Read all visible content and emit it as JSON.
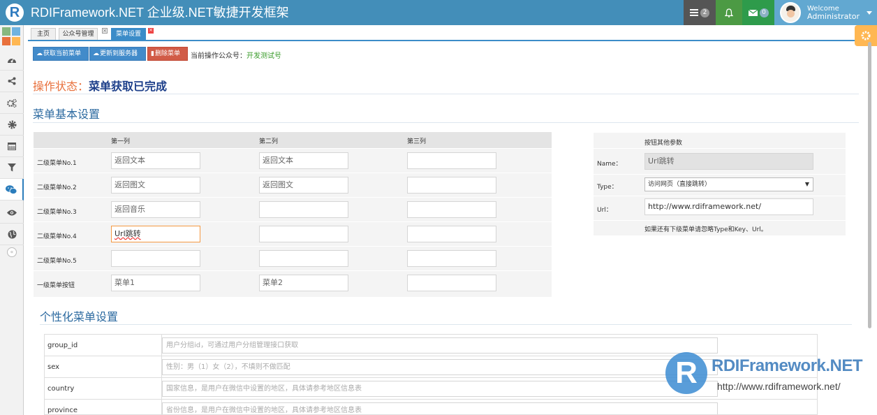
{
  "navbar": {
    "brand_letter": "R",
    "brand_title": "RDIFramework.NET 企业级.NET敏捷开发框架",
    "tasks_badge": "2",
    "mail_badge": "0",
    "user_welcome": "Welcome",
    "user_name": "Administrator",
    "colors": {
      "bar": "#438eb9",
      "tasks": "#555555",
      "bell": "#4c9a44",
      "mail": "#2e9b4b",
      "user": "#62a8d1"
    }
  },
  "sidebar": {
    "shortcut_colors": [
      "#87b87f",
      "#6fb3e0",
      "#e8703c",
      "#ffb752"
    ],
    "icons": [
      "dashboard-icon",
      "share-icon",
      "cogs-icon",
      "gear-icon",
      "calendar-icon",
      "filter-icon",
      "wechat-icon",
      "eye-icon",
      "globe-icon"
    ],
    "collapse_glyph": "«"
  },
  "tabs": [
    {
      "label": "主页"
    },
    {
      "label": "公众号管理"
    },
    {
      "label": "菜单设置"
    }
  ],
  "toolbar": {
    "fetch_label": "获取当前菜单",
    "update_label": "更新到服务器",
    "delete_label": "删除菜单",
    "account_prefix": "当前操作公众号：",
    "account_name": "开发测试号"
  },
  "status": {
    "label": "操作状态：",
    "value": "菜单获取已完成"
  },
  "basic": {
    "title": "菜单基本设置",
    "columns": [
      "第一列",
      "第二列",
      "第三列"
    ],
    "rows": [
      {
        "label": "二级菜单No.1",
        "values": [
          "返回文本",
          "返回文本",
          ""
        ]
      },
      {
        "label": "二级菜单No.2",
        "values": [
          "返回图文",
          "返回图文",
          ""
        ]
      },
      {
        "label": "二级菜单No.3",
        "values": [
          "返回音乐",
          "",
          ""
        ]
      },
      {
        "label": "二级菜单No.4",
        "values": [
          "Url跳转",
          "",
          ""
        ]
      },
      {
        "label": "二级菜单No.5",
        "values": [
          "",
          "",
          ""
        ]
      },
      {
        "label": "一级菜单按钮",
        "values": [
          "菜单1",
          "菜单2",
          ""
        ]
      }
    ]
  },
  "params": {
    "title": "按钮其他参数",
    "name_label": "Name：",
    "name_value": "Url跳转",
    "type_label": "Type：",
    "type_value": "访问网页（直接跳转）",
    "url_label": "Url：",
    "url_value": "http://www.rdiframework.net/",
    "note": "如果还有下级菜单请忽略Type和Key、Url。"
  },
  "personal": {
    "title": "个性化菜单设置",
    "rows": [
      {
        "key": "group_id",
        "placeholder": "用户分组id，可通过用户分组管理接口获取"
      },
      {
        "key": "sex",
        "placeholder": "性别：男（1）女（2），不填则不做匹配"
      },
      {
        "key": "country",
        "placeholder": "国家信息，是用户在微信中设置的地区，具体请参考地区信息表"
      },
      {
        "key": "province",
        "placeholder": "省份信息，是用户在微信中设置的地区，具体请参考地区信息表"
      }
    ]
  },
  "watermark": {
    "letter": "R",
    "name": "RDIFramework.NET",
    "url": "http://www.rdiframework.net/"
  }
}
